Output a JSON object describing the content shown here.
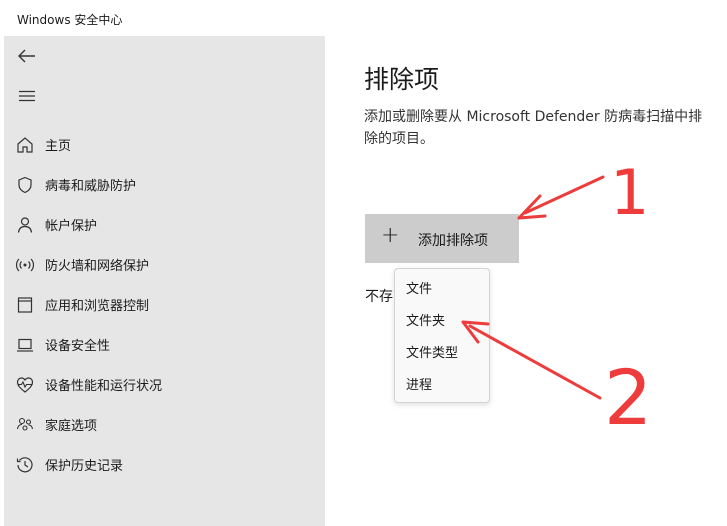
{
  "window": {
    "title": "Windows 安全中心"
  },
  "sidebar": {
    "icons": {
      "back": "back-arrow-icon",
      "menu": "hamburger-menu-icon"
    },
    "items": [
      {
        "label": "主页",
        "icon": "home-icon"
      },
      {
        "label": "病毒和威胁防护",
        "icon": "shield-icon"
      },
      {
        "label": "帐户保护",
        "icon": "person-icon"
      },
      {
        "label": "防火墙和网络保护",
        "icon": "wifi-antenna-icon"
      },
      {
        "label": "应用和浏览器控制",
        "icon": "app-window-icon"
      },
      {
        "label": "设备安全性",
        "icon": "laptop-icon"
      },
      {
        "label": "设备性能和运行状况",
        "icon": "heart-pulse-icon"
      },
      {
        "label": "家庭选项",
        "icon": "family-icon"
      },
      {
        "label": "保护历史记录",
        "icon": "history-icon"
      }
    ]
  },
  "main": {
    "title": "排除项",
    "description": "添加或删除要从 Microsoft Defender 防病毒扫描中排除的项目。",
    "add_button": {
      "icon": "plus-icon",
      "label": "添加排除项"
    },
    "partial_text": "不存"
  },
  "dropdown": {
    "items": [
      {
        "label": "文件"
      },
      {
        "label": "文件夹"
      },
      {
        "label": "文件类型"
      },
      {
        "label": "进程"
      }
    ]
  },
  "annotations": {
    "color": "#ee3b3b",
    "step1_label": "1",
    "step2_label": "2"
  }
}
